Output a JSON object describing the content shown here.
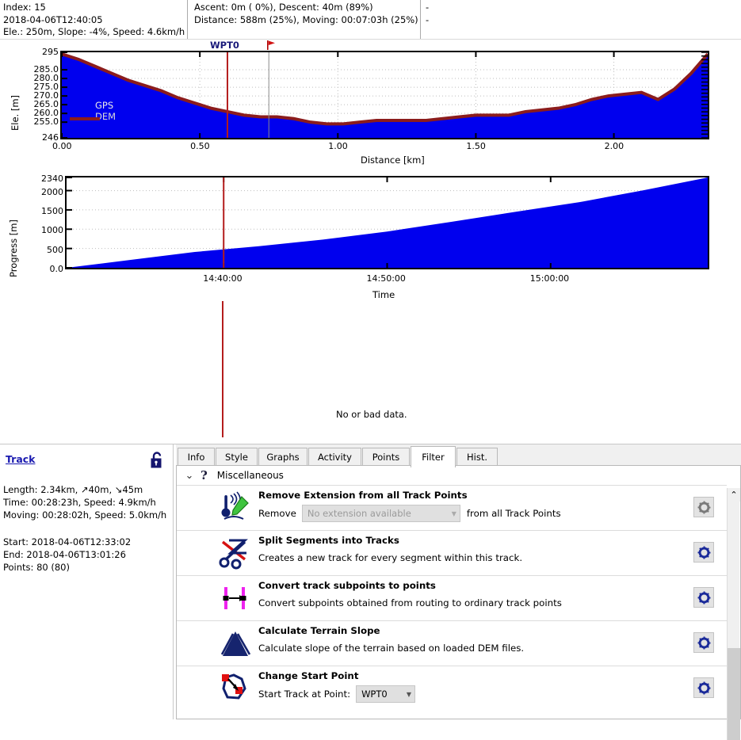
{
  "infobar": {
    "col1": [
      "Index: 15",
      "2018-04-06T12:40:05",
      "Ele.: 250m, Slope: -4%, Speed: 4.6km/h"
    ],
    "col2": [
      "Ascent: 0m ( 0%), Descent: 40m (89%)",
      "Distance: 588m (25%), Moving: 00:07:03h (25%)"
    ],
    "col3": [
      "-",
      "-"
    ]
  },
  "chart_data": [
    {
      "type": "area",
      "title": "",
      "xlabel": "Distance [km]",
      "ylabel": "Ele. [m]",
      "xlim": [
        0.0,
        2.34
      ],
      "ylim": [
        246,
        295
      ],
      "xticks": [
        "0.00",
        "0.50",
        "1.00",
        "1.50",
        "2.00"
      ],
      "xtick_values": [
        0.0,
        0.5,
        1.0,
        1.5,
        2.0
      ],
      "yticks": [
        "295",
        "285.0",
        "280.0",
        "275.0",
        "270.0",
        "265.0",
        "260.0",
        "255.0",
        "246"
      ],
      "ytick_values": [
        295,
        285,
        280,
        275,
        270,
        265,
        260,
        255,
        246
      ],
      "grid": true,
      "legend": [
        "GPS",
        "DEM"
      ],
      "legend_position": "upper-left-inside",
      "fill_color": "#0000ee",
      "line_color": "#8b1c1c",
      "x": [
        0.0,
        0.06,
        0.12,
        0.18,
        0.24,
        0.3,
        0.36,
        0.42,
        0.48,
        0.54,
        0.6,
        0.66,
        0.72,
        0.78,
        0.84,
        0.9,
        0.96,
        1.02,
        1.08,
        1.14,
        1.2,
        1.26,
        1.32,
        1.38,
        1.44,
        1.5,
        1.56,
        1.62,
        1.68,
        1.74,
        1.8,
        1.86,
        1.92,
        1.98,
        2.04,
        2.1,
        2.16,
        2.22,
        2.28,
        2.34
      ],
      "y": [
        294,
        291,
        287,
        283,
        279,
        276,
        273,
        269,
        266,
        263,
        261,
        259,
        258,
        258,
        257,
        255,
        254,
        254,
        255,
        256,
        256,
        256,
        256,
        257,
        258,
        259,
        259,
        259,
        261,
        262,
        263,
        265,
        268,
        270,
        271,
        272,
        268,
        274,
        283,
        294
      ],
      "cursor": {
        "label": "WPT0",
        "x": 0.6,
        "color": "#b41d1d"
      },
      "marker": {
        "label": "flag",
        "x": 0.75,
        "color": "#cc0000",
        "line_color": "#8a8a8a"
      }
    },
    {
      "type": "area",
      "title": "",
      "xlabel": "Time",
      "ylabel": "Progress [m]",
      "ylim": [
        0,
        2340
      ],
      "yticks": [
        "2340",
        "2000",
        "1500",
        "1000",
        "500",
        "0.0"
      ],
      "ytick_values": [
        2340,
        2000,
        1500,
        1000,
        500,
        0
      ],
      "xticks": [
        "14:40:00",
        "14:50:00",
        "15:00:00"
      ],
      "grid": true,
      "fill_color": "#0000ee",
      "x_frac": [
        0.0,
        0.1,
        0.2,
        0.3,
        0.4,
        0.5,
        0.6,
        0.7,
        0.8,
        0.9,
        1.0
      ],
      "y": [
        0,
        205,
        410,
        560,
        730,
        940,
        1190,
        1450,
        1700,
        2010,
        2340
      ],
      "cursor": {
        "x_frac": 0.245,
        "color": "#b41d1d"
      }
    },
    {
      "type": "empty",
      "message": "No or bad data.",
      "cursor": {
        "color": "#b41d1d"
      }
    }
  ],
  "sidebar": {
    "title": "Track",
    "lock_icon": "unlocked-padlock-icon",
    "lines": [
      "Length: 2.34km, ↗40m, ↘45m",
      "Time: 00:28:23h, Speed: 4.9km/h",
      "Moving: 00:28:02h, Speed: 5.0km/h",
      "Start: 2018-04-06T12:33:02",
      "End: 2018-04-06T13:01:26",
      "Points: 80 (80)"
    ]
  },
  "panel": {
    "tabs": [
      {
        "label": "Info",
        "active": false
      },
      {
        "label": "Style",
        "active": false
      },
      {
        "label": "Graphs",
        "active": false
      },
      {
        "label": "Activity",
        "active": false
      },
      {
        "label": "Points",
        "active": false
      },
      {
        "label": "Filter",
        "active": true
      },
      {
        "label": "Hist.",
        "active": false
      }
    ],
    "group": {
      "chevron": "⌄",
      "help": "?",
      "title": "Miscellaneous"
    },
    "filters": [
      {
        "title": "Remove Extension from all Track Points",
        "icon": "thermometer-pen-icon",
        "pre_label": "Remove",
        "combo_value": "No extension available",
        "combo_disabled": true,
        "post_label": "from all Track Points",
        "gear_disabled": true
      },
      {
        "title": "Split Segments into Tracks",
        "icon": "scissors-icon",
        "desc": "Creates a new track for every segment within this track.",
        "gear_disabled": false
      },
      {
        "title": "Convert track subpoints to points",
        "icon": "subpoints-arrow-icon",
        "desc": "Convert subpoints obtained from routing to ordinary track points",
        "gear_disabled": false
      },
      {
        "title": "Calculate Terrain Slope",
        "icon": "mountain-icon",
        "desc": "Calculate slope of the terrain based on loaded DEM files.",
        "gear_disabled": false
      },
      {
        "title": "Change Start Point",
        "icon": "change-start-point-icon",
        "pre_label": "Start Track at Point:",
        "combo_value": "WPT0",
        "combo_disabled": false,
        "gear_disabled": false
      }
    ],
    "scrollbar": {
      "up_arrow": "⌃"
    }
  }
}
